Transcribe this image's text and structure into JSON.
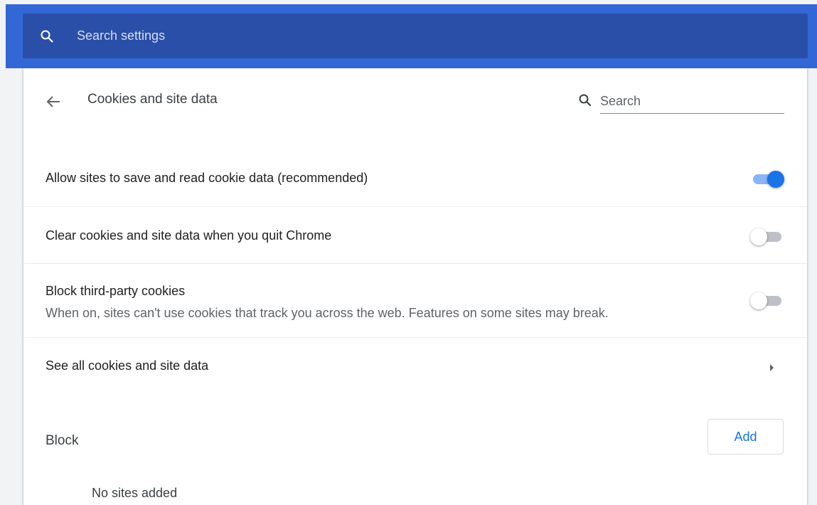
{
  "top_bar": {
    "search_placeholder": "Search settings",
    "color": "#3367d6"
  },
  "subpage": {
    "title": "Cookies and site data",
    "search_placeholder": "Search"
  },
  "settings": [
    {
      "label": "Allow sites to save and read cookie data (recommended)",
      "toggle_on": true
    },
    {
      "label": "Clear cookies and site data when you quit Chrome",
      "toggle_on": false
    },
    {
      "label": "Block third-party cookies",
      "sublabel": "When on, sites can't use cookies that track you across the web. Features on some sites may break.",
      "toggle_on": false
    }
  ],
  "see_all": {
    "label": "See all cookies and site data"
  },
  "block": {
    "label": "Block",
    "add_label": "Add",
    "empty_text": "No sites added"
  },
  "colors": {
    "accent": "#1a73e8",
    "toggle_on_track": "#8ab4f8",
    "toggle_off_track": "#bdc1c6"
  }
}
